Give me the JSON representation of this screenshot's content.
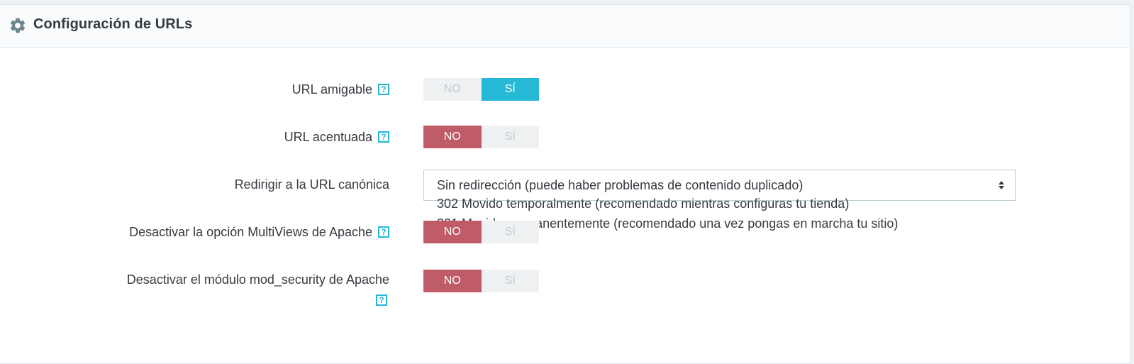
{
  "panel": {
    "title": "Configuración de URLs",
    "icon": "gear-icon"
  },
  "settings": {
    "friendly_url": {
      "label": "URL amigable",
      "no": "NO",
      "yes": "SÍ",
      "selected": "yes"
    },
    "accented_url": {
      "label": "URL acentuada",
      "no": "NO",
      "yes": "SÍ",
      "selected": "no"
    },
    "canonical_redirect": {
      "label": "Redirigir a la URL canónica",
      "selected": "Sin redirección (puede haber problemas de contenido duplicado)",
      "options": [
        "302 Movido temporalmente (recomendado mientras configuras tu tienda)",
        "301 Movido permanentemente (recomendado una vez pongas en marcha tu sitio)"
      ]
    },
    "multiviews": {
      "label": "Desactivar la opción MultiViews de Apache",
      "no": "NO",
      "yes": "SÍ",
      "selected": "no"
    },
    "mod_security": {
      "label": "Desactivar el módulo mod_security de Apache",
      "no": "NO",
      "yes": "SÍ",
      "selected": "no"
    }
  },
  "help_glyph": "?",
  "colors": {
    "yes_active": "#25b9d7",
    "no_active": "#c05c67",
    "help": "#25b9d7"
  }
}
